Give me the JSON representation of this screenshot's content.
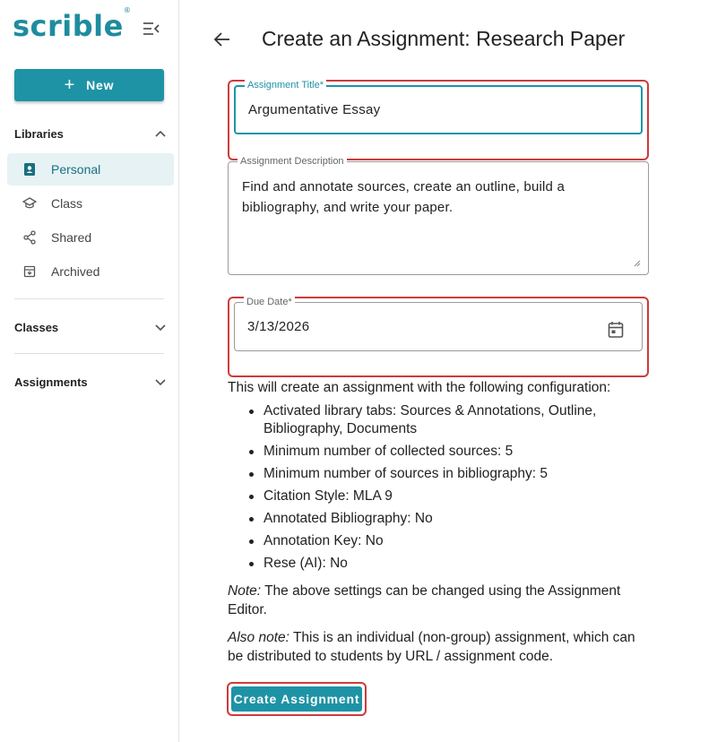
{
  "sidebar": {
    "logo": "scrible",
    "logo_mark": "®",
    "new_button": {
      "label": "New",
      "icon": "plus-icon"
    },
    "libraries": {
      "label": "Libraries",
      "expanded": true,
      "items": [
        {
          "label": "Personal",
          "icon": "person-book-icon",
          "active": true
        },
        {
          "label": "Class",
          "icon": "graduation-cap-icon"
        },
        {
          "label": "Shared",
          "icon": "share-icon"
        },
        {
          "label": "Archived",
          "icon": "archive-box-icon"
        }
      ]
    },
    "classes": {
      "label": "Classes",
      "expanded": false
    },
    "assignments": {
      "label": "Assignments",
      "expanded": false
    }
  },
  "header": {
    "title": "Create an Assignment: Research Paper"
  },
  "form": {
    "title_field": {
      "label": "Assignment Title*",
      "value": "Argumentative Essay"
    },
    "description_field": {
      "label": "Assignment Description",
      "value": "Find and annotate sources, create an outline, build a bibliography, and write your paper."
    },
    "due_date_field": {
      "label": "Due Date*",
      "value": "3/13/2026"
    }
  },
  "config": {
    "intro": "This will create an assignment with the following configuration:",
    "items": [
      "Activated library tabs: Sources & Annotations, Outline, Bibliography, Documents",
      "Minimum number of collected sources: 5",
      "Minimum number of sources in bibliography: 5",
      "Citation Style: MLA 9",
      "Annotated Bibliography: No",
      "Annotation Key: No",
      "Rese (AI): No"
    ],
    "note_label": "Note:",
    "note_text": " The above settings can be changed using the Assignment Editor.",
    "also_note_label": "Also note:",
    "also_note_text": " This is an individual (non-group) assignment, which can be distributed to students by URL / assignment code."
  },
  "actions": {
    "create_label": "Create Assignment"
  },
  "colors": {
    "brand": "#1e93a6",
    "highlight": "#d03a3a",
    "active_bg": "#e6f2f4"
  }
}
